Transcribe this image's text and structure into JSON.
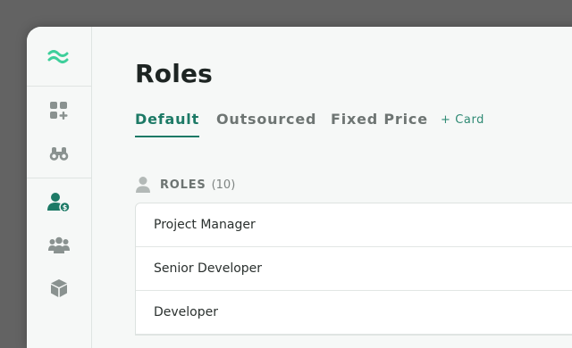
{
  "sidebar": {
    "logo": "wave-logo-icon",
    "items": [
      {
        "icon": "apps-add-icon",
        "active": false
      },
      {
        "icon": "binoculars-icon",
        "active": false
      },
      {
        "icon": "user-dollar-icon",
        "active": true
      },
      {
        "icon": "team-icon",
        "active": false
      },
      {
        "icon": "cube-icon",
        "active": false
      }
    ],
    "colors": {
      "logo": "#3ecf9b",
      "active": "#1d7a66",
      "inactive": "#8a9290"
    }
  },
  "header": {
    "title": "Roles"
  },
  "tabs": [
    {
      "label": "Default",
      "active": true
    },
    {
      "label": "Outsourced",
      "active": false
    },
    {
      "label": "Fixed Price",
      "active": false
    }
  ],
  "add_card_label": "+ Card",
  "roles_section": {
    "label": "ROLES",
    "count": "(10)",
    "icon": "person-icon",
    "items": [
      "Project Manager",
      "Senior Developer",
      "Developer"
    ]
  }
}
